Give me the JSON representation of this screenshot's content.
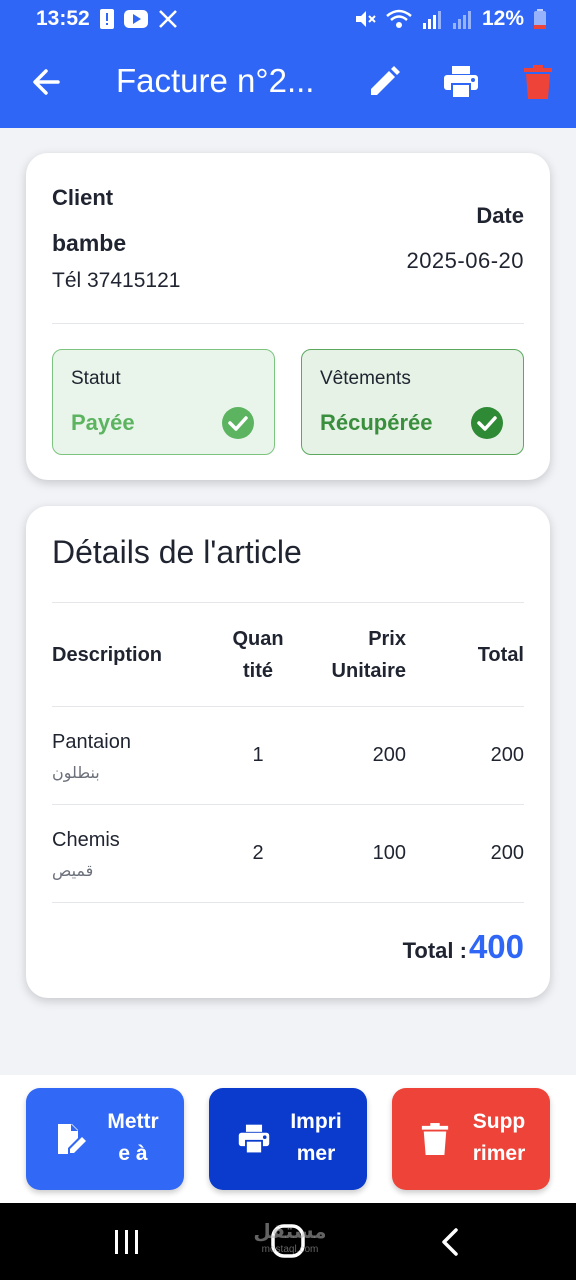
{
  "status_bar": {
    "time": "13:52",
    "battery": "12%",
    "icons": [
      "alert-icon",
      "youtube-icon",
      "x-icon",
      "mute-icon",
      "wifi-icon",
      "signal-icon",
      "signal-icon",
      "battery-icon"
    ]
  },
  "app_bar": {
    "title": "Facture n°2...",
    "icons": [
      "back-arrow-icon",
      "edit-icon",
      "print-icon",
      "delete-icon"
    ]
  },
  "client_card": {
    "client_label": "Client",
    "client_name": "bambe",
    "client_phone": "Tél 37415121",
    "date_label": "Date",
    "date_value": "2025-06-20",
    "status_label": "Statut",
    "status_value": "Payée",
    "clothes_label": "Vêtements",
    "clothes_value": "Récupérée",
    "colors": {
      "paid": "#5cb460",
      "collected": "#3a8f3e"
    }
  },
  "details_card": {
    "title": "Détails de l'article",
    "headers": {
      "description": "Description",
      "quantity": "Quan\ntité",
      "unit_price": "Prix\nUnitaire",
      "total": "Total"
    },
    "rows": [
      {
        "name": "Pantaion",
        "name_ar": "بنطلون",
        "qty": "1",
        "unit_price": "200",
        "total": "200"
      },
      {
        "name": "Chemis",
        "name_ar": "قميص",
        "qty": "2",
        "unit_price": "100",
        "total": "200"
      }
    ],
    "grand_total_label": "Total :",
    "grand_total_value": "400"
  },
  "actions": {
    "update_label": "Mettr\ne à",
    "print_label": "Impri\nmer",
    "delete_label": "Supp\nrimer",
    "colors": {
      "update": "#3168f5",
      "print": "#0b3bcc",
      "delete": "#ee4339"
    }
  },
  "watermark": {
    "text": "مستقل",
    "sub": "mostaql.com"
  },
  "accent_color": "#2f66f6"
}
